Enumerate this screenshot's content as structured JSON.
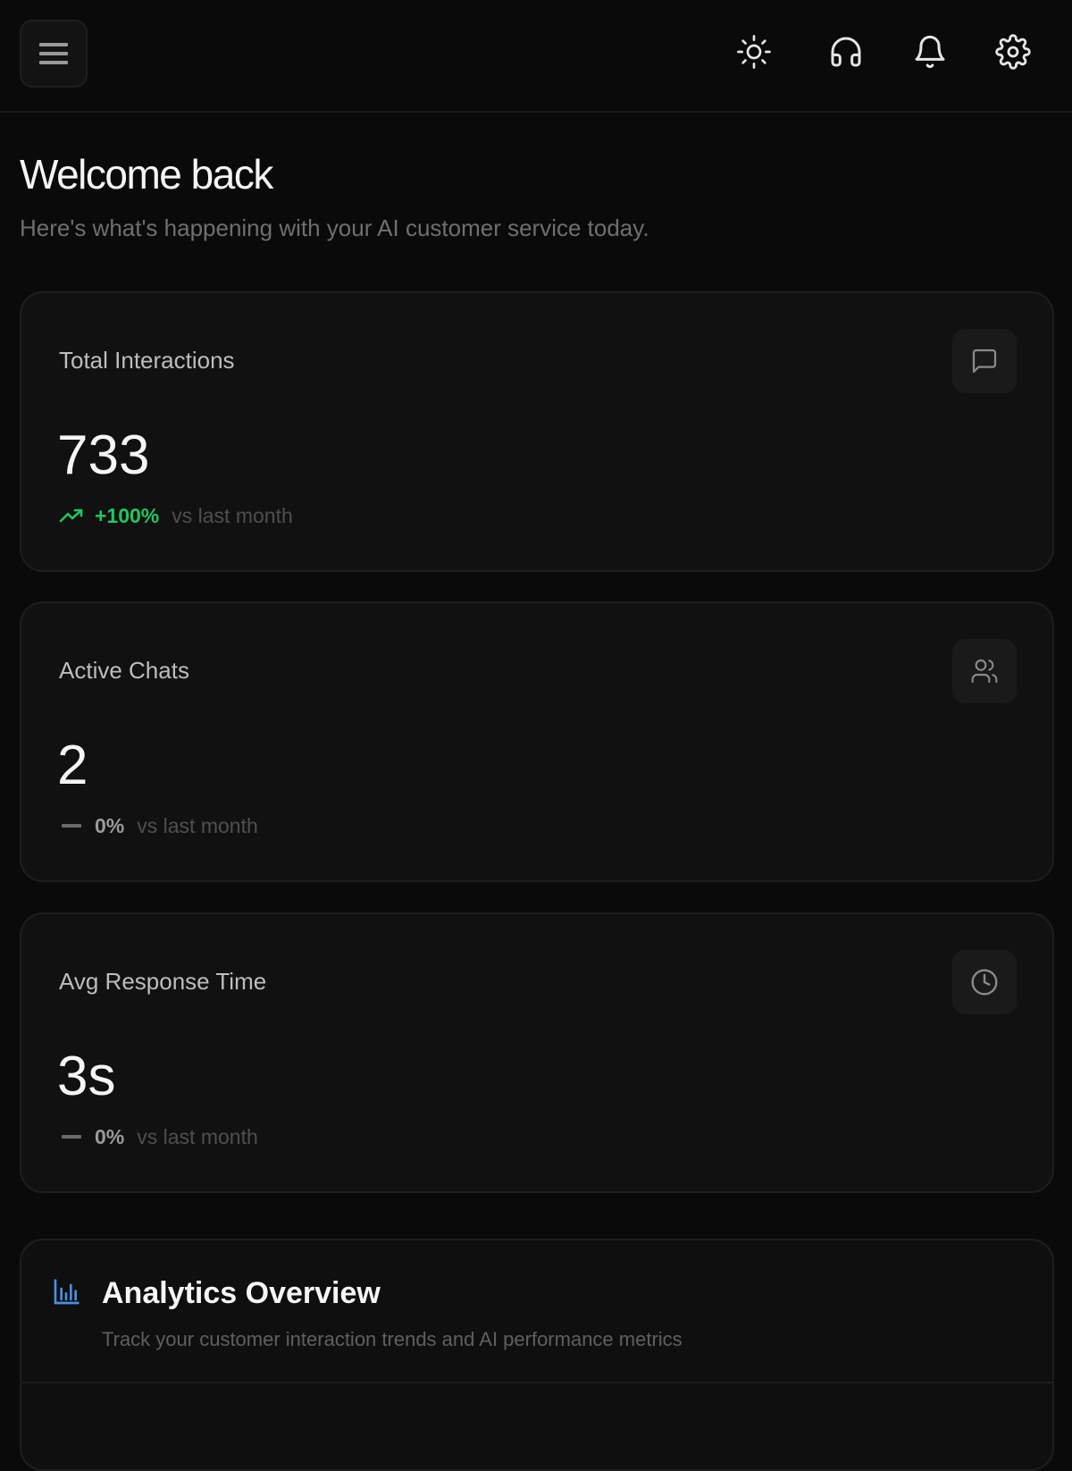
{
  "header": {
    "icons": {
      "menu": "menu-icon",
      "theme": "sun-icon",
      "support": "headphones-icon",
      "notifications": "bell-icon",
      "settings": "gear-icon"
    }
  },
  "welcome": {
    "title": "Welcome back",
    "subtitle": "Here's what's happening with your AI customer service today."
  },
  "stats": [
    {
      "label": "Total Interactions",
      "value": "733",
      "change": "+100%",
      "change_note": "vs last month",
      "trend": "up",
      "icon": "message-square-icon"
    },
    {
      "label": "Active Chats",
      "value": "2",
      "change": "0%",
      "change_note": "vs last month",
      "trend": "flat",
      "icon": "users-icon"
    },
    {
      "label": "Avg Response Time",
      "value": "3s",
      "change": "0%",
      "change_note": "vs last month",
      "trend": "flat",
      "icon": "clock-icon"
    }
  ],
  "analytics": {
    "title": "Analytics Overview",
    "subtitle": "Track your customer interaction trends and AI performance metrics",
    "icon": "bar-chart-icon"
  },
  "colors": {
    "background": "#0a0a0a",
    "card": "#111111",
    "trend_up": "#22c55e",
    "trend_flat": "#9a9a9a",
    "accent_blue": "#4a90e2"
  }
}
